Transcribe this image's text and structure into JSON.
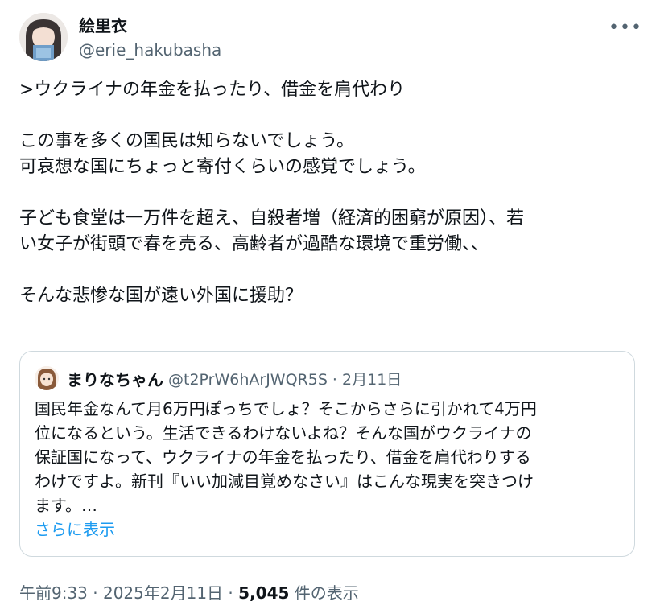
{
  "author": {
    "display_name": "絵里衣",
    "handle": "@erie_hakubasha"
  },
  "more_icon": "more-horizontal-icon",
  "post": {
    "lines": [
      ">ウクライナの年金を払ったり、借金を肩代わり",
      "",
      "この事を多くの国民は知らないでしょう。",
      "可哀想な国にちょっと寄付くらいの感覚でしょう。",
      "",
      "子ども食堂は一万件を超え、自殺者増（経済的困窮が原因）、若",
      "い女子が街頭で春を売る、高齢者が過酷な環境で重労働、、",
      "",
      "そんな悲惨な国が遠い外国に援助？"
    ]
  },
  "quoted": {
    "display_name": "まりなちゃん",
    "meta": "@t2PrW6hArJWQR5S · 2月11日",
    "lines": [
      "国民年金なんて月6万円ぽっちでしょ？そこからさらに引かれて4万円",
      "位になるという。生活できるわけないよね？そんな国がウクライナの",
      "保証国になって、ウクライナの年金を払ったり、借金を肩代わりする",
      "わけですよ。新刊『いい加減目覚めなさい』はこんな現実を突きつけ",
      "ます。…"
    ],
    "show_more": "さらに表示"
  },
  "footer": {
    "timestamp": "午前9:33 · 2025年2月11日 · ",
    "views_count": "5,045",
    "views_label": " 件の表示"
  }
}
